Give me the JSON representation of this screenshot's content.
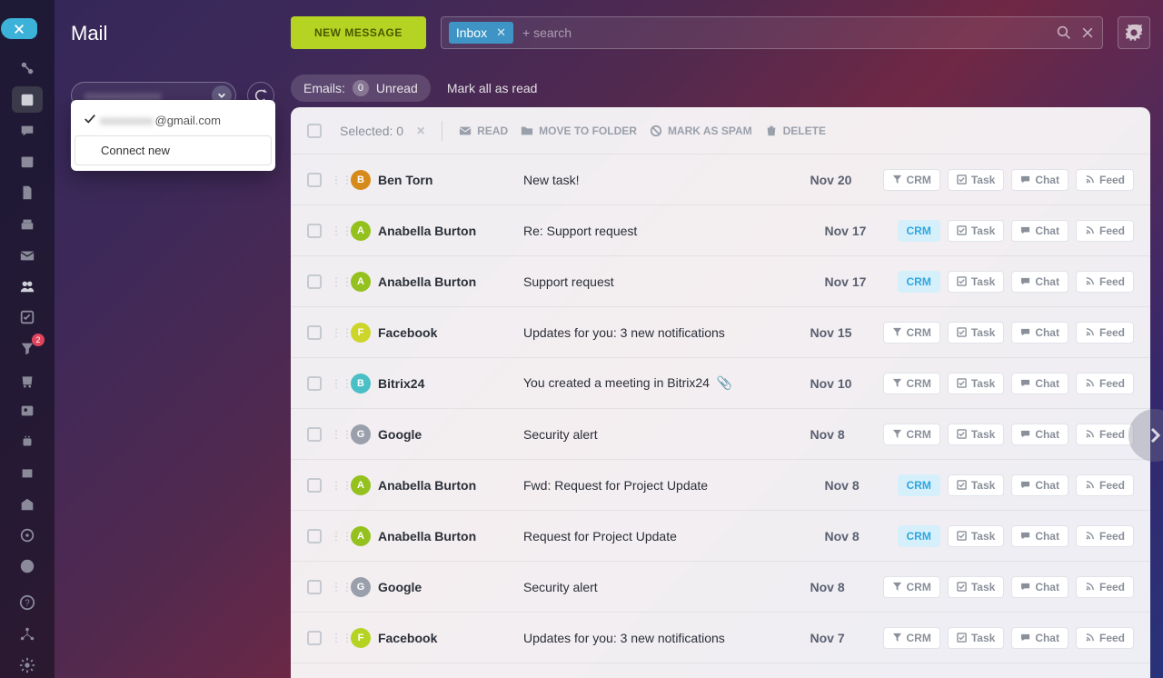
{
  "page_title": "Mail",
  "new_message_label": "NEW MESSAGE",
  "search": {
    "tag": "Inbox",
    "placeholder": "+ search"
  },
  "filters": {
    "emails_label": "Emails:",
    "unread_count": "0",
    "unread_label": "Unread",
    "mark_all_label": "Mark all as read"
  },
  "toolbar": {
    "selected_label": "Selected: 0",
    "read": "READ",
    "move": "MOVE TO FOLDER",
    "spam": "MARK AS SPAM",
    "delete": "DELETE"
  },
  "account_dropdown": {
    "email_domain": "@gmail.com",
    "connect_new": "Connect new"
  },
  "rail_badge": "2",
  "action_labels": {
    "crm": "CRM",
    "task": "Task",
    "chat": "Chat",
    "feed": "Feed"
  },
  "emails": [
    {
      "initial": "B",
      "avatar": "av-orange",
      "sender": "Ben Torn",
      "subject": "New task!",
      "date": "Nov 20",
      "crm_active": false,
      "attach": false
    },
    {
      "initial": "A",
      "avatar": "av-green",
      "sender": "Anabella Burton",
      "subject": "Re: Support request",
      "date": "Nov 17",
      "crm_active": true,
      "attach": false
    },
    {
      "initial": "A",
      "avatar": "av-green",
      "sender": "Anabella Burton",
      "subject": "Support request",
      "date": "Nov 17",
      "crm_active": true,
      "attach": false
    },
    {
      "initial": "F",
      "avatar": "av-yellow",
      "sender": "Facebook",
      "subject": "Updates for you: 3 new notifications",
      "date": "Nov 15",
      "crm_active": false,
      "attach": false
    },
    {
      "initial": "B",
      "avatar": "av-teal",
      "sender": "Bitrix24",
      "subject": "You created a meeting in Bitrix24",
      "date": "Nov 10",
      "crm_active": false,
      "attach": true
    },
    {
      "initial": "G",
      "avatar": "av-grey",
      "sender": "Google",
      "subject": "Security alert",
      "date": "Nov 8",
      "crm_active": false,
      "attach": false
    },
    {
      "initial": "A",
      "avatar": "av-green",
      "sender": "Anabella Burton",
      "subject": "Fwd: Request for Project Update",
      "date": "Nov 8",
      "crm_active": true,
      "attach": false
    },
    {
      "initial": "A",
      "avatar": "av-green",
      "sender": "Anabella Burton",
      "subject": "Request for Project Update",
      "date": "Nov 8",
      "crm_active": true,
      "attach": false
    },
    {
      "initial": "G",
      "avatar": "av-grey",
      "sender": "Google",
      "subject": "Security alert",
      "date": "Nov 8",
      "crm_active": false,
      "attach": false
    },
    {
      "initial": "F",
      "avatar": "av-lime",
      "sender": "Facebook",
      "subject": "Updates for you: 3 new notifications",
      "date": "Nov 7",
      "crm_active": false,
      "attach": false
    }
  ]
}
